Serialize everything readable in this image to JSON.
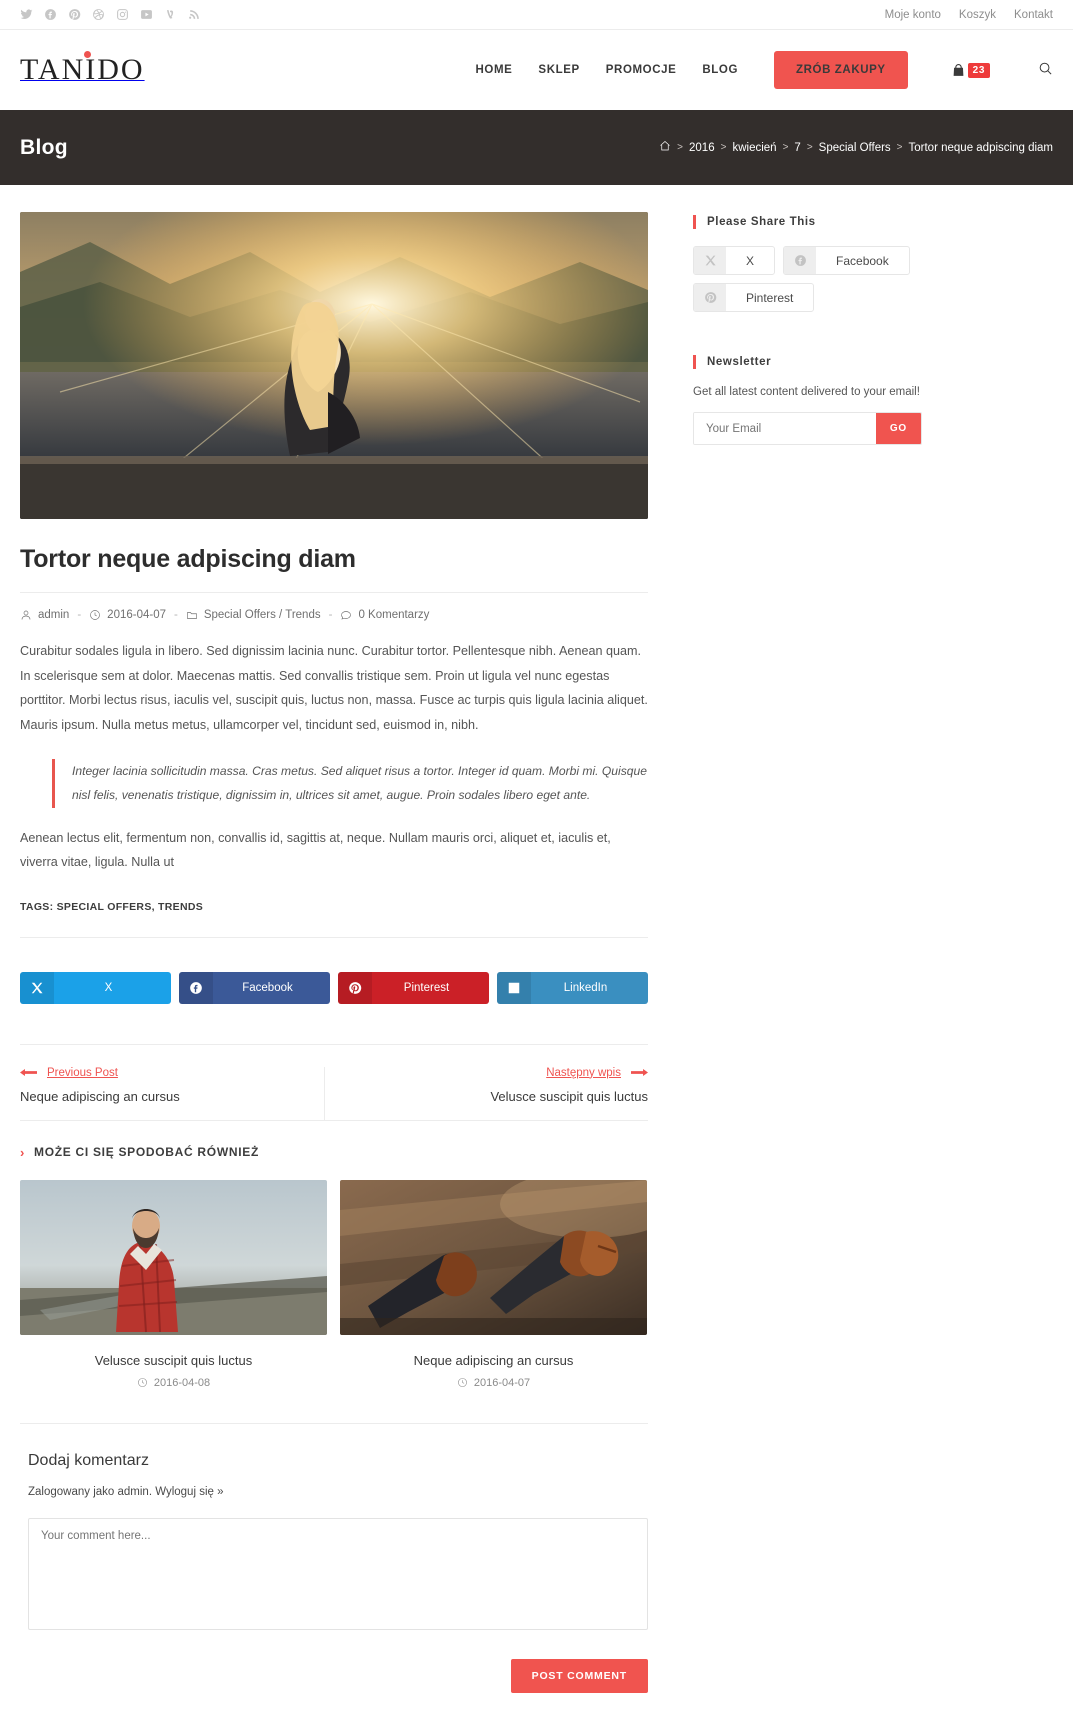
{
  "topbar": {
    "social": [
      {
        "name": "twitter-icon",
        "label": "Twitter"
      },
      {
        "name": "facebook-icon",
        "label": "Facebook"
      },
      {
        "name": "pinterest-icon",
        "label": "Pinterest"
      },
      {
        "name": "dribbble-icon",
        "label": "Dribbble"
      },
      {
        "name": "instagram-icon",
        "label": "Instagram"
      },
      {
        "name": "youtube-icon",
        "label": "YouTube"
      },
      {
        "name": "vine-icon",
        "label": "Vine"
      },
      {
        "name": "rss-icon",
        "label": "RSS"
      }
    ],
    "links": [
      "Moje konto",
      "Koszyk",
      "Kontakt"
    ]
  },
  "header": {
    "logo": "TANIDO",
    "nav": [
      "HOME",
      "SKLEP",
      "PROMOCJE",
      "BLOG"
    ],
    "cta": "ZRÓB ZAKUPY",
    "cart_count": "23"
  },
  "titlebar": {
    "title": "Blog",
    "breadcrumb": [
      "2016",
      "kwiecień",
      "7",
      "Special Offers",
      "Tortor neque adpiscing diam"
    ],
    "separator": ">"
  },
  "post": {
    "title": "Tortor neque adpiscing diam",
    "author": "admin",
    "date": "2016-04-07",
    "categories": "Special Offers / Trends",
    "comments": "0 Komentarzy",
    "paragraph1": "Curabitur sodales ligula in libero. Sed dignissim lacinia nunc. Curabitur tortor. Pellentesque nibh. Aenean quam. In scelerisque sem at dolor. Maecenas mattis. Sed convallis tristique sem. Proin ut ligula vel nunc egestas porttitor. Morbi lectus risus, iaculis vel, suscipit quis, luctus non, massa. Fusce ac turpis quis ligula lacinia aliquet. Mauris ipsum. Nulla metus metus, ullamcorper vel, tincidunt sed, euismod in, nibh.",
    "blockquote": "Integer lacinia sollicitudin massa. Cras metus. Sed aliquet risus a tortor. Integer id quam. Morbi mi. Quisque nisl felis, venenatis tristique, dignissim in, ultrices sit amet, augue. Proin sodales libero eget ante.",
    "paragraph2": "Aenean lectus elit, fermentum non, convallis id, sagittis at, neque. Nullam mauris orci, aliquet et, iaculis et, viverra vitae, ligula. Nulla ut",
    "tags": "TAGS: SPECIAL OFFERS, TRENDS"
  },
  "share_buttons": [
    {
      "label": "X",
      "icon": "x-icon",
      "color": "#1ba1e8"
    },
    {
      "label": "Facebook",
      "icon": "facebook-icon",
      "color": "#3b5998"
    },
    {
      "label": "Pinterest",
      "icon": "pinterest-icon",
      "color": "#cb2027"
    },
    {
      "label": "LinkedIn",
      "icon": "linkedin-icon",
      "color": "#3a8fc0"
    }
  ],
  "postnav": {
    "prev_label": "Previous Post",
    "prev_title": "Neque adipiscing an cursus",
    "next_label": "Następny wpis",
    "next_title": "Velusce suscipit quis luctus"
  },
  "related": {
    "heading": "MOŻE CI SIĘ SPODOBAĆ RÓWNIEŻ",
    "items": [
      {
        "title": "Velusce suscipit quis luctus",
        "date": "2016-04-08"
      },
      {
        "title": "Neque adipiscing an cursus",
        "date": "2016-04-07"
      }
    ]
  },
  "comment_form": {
    "heading": "Dodaj komentarz",
    "logged_in": "Zalogowany jako admin. Wyloguj się »",
    "placeholder": "Your comment here...",
    "submit": "POST COMMENT"
  },
  "sidebar": {
    "share_heading": "Please Share This",
    "share_buttons": [
      {
        "label": "X",
        "icon": "x-icon"
      },
      {
        "label": "Facebook",
        "icon": "facebook-icon"
      },
      {
        "label": "Pinterest",
        "icon": "pinterest-icon"
      }
    ],
    "newsletter_heading": "Newsletter",
    "newsletter_desc": "Get all latest content delivered to your email!",
    "newsletter_placeholder": "Your Email",
    "newsletter_button": "GO"
  },
  "colors": {
    "accent": "#ef5350",
    "cta": "#f0544f",
    "titlebar": "#332e2c",
    "badge": "#ee3b3b"
  }
}
